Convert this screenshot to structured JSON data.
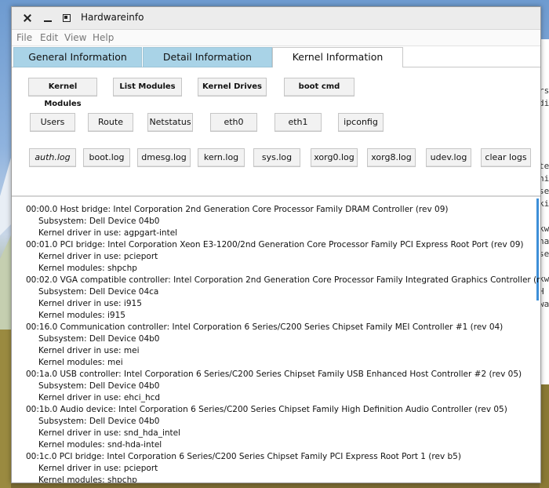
{
  "window": {
    "title": "Hardwareinfo"
  },
  "menu": [
    "File",
    "Edit",
    "View",
    "Help"
  ],
  "tabs": [
    {
      "label": "General Information",
      "active": false
    },
    {
      "label": "Detail Information",
      "active": false
    },
    {
      "label": "Kernel Information",
      "active": true
    }
  ],
  "buttons": {
    "row1": [
      "Kernel Modules",
      "List Modules",
      "Kernel Drives",
      "boot cmd"
    ],
    "row2": [
      "Users",
      "Route",
      "Netstatus",
      "eth0",
      "eth1",
      "ipconfig"
    ],
    "row3": [
      "auth.log",
      "boot.log",
      "dmesg.log",
      "kern.log",
      "sys.log",
      "xorg0.log",
      "xorg8.log",
      "udev.log",
      "clear logs"
    ]
  },
  "output": [
    {
      "text": "00:00.0 Host bridge: Intel Corporation 2nd Generation Core Processor Family DRAM Controller (rev 09)",
      "indent": false
    },
    {
      "text": "Subsystem: Dell Device 04b0",
      "indent": true
    },
    {
      "text": "Kernel driver in use: agpgart-intel",
      "indent": true
    },
    {
      "text": "00:01.0 PCI bridge: Intel Corporation Xeon E3-1200/2nd Generation Core Processor Family PCI Express Root Port (rev 09)",
      "indent": false
    },
    {
      "text": "Kernel driver in use: pcieport",
      "indent": true
    },
    {
      "text": "Kernel modules: shpchp",
      "indent": true
    },
    {
      "text": "00:02.0 VGA compatible controller: Intel Corporation 2nd Generation Core Processor Family Integrated Graphics Controller (rev 09)",
      "indent": false
    },
    {
      "text": "Subsystem: Dell Device 04ca",
      "indent": true
    },
    {
      "text": "Kernel driver in use: i915",
      "indent": true
    },
    {
      "text": "Kernel modules: i915",
      "indent": true
    },
    {
      "text": "00:16.0 Communication controller: Intel Corporation 6 Series/C200 Series Chipset Family MEI Controller #1 (rev 04)",
      "indent": false
    },
    {
      "text": "Subsystem: Dell Device 04b0",
      "indent": true
    },
    {
      "text": "Kernel driver in use: mei",
      "indent": true
    },
    {
      "text": "Kernel modules: mei",
      "indent": true
    },
    {
      "text": "00:1a.0 USB controller: Intel Corporation 6 Series/C200 Series Chipset Family USB Enhanced Host Controller #2 (rev 05)",
      "indent": false
    },
    {
      "text": "Subsystem: Dell Device 04b0",
      "indent": true
    },
    {
      "text": "Kernel driver in use: ehci_hcd",
      "indent": true
    },
    {
      "text": "00:1b.0 Audio device: Intel Corporation 6 Series/C200 Series Chipset Family High Definition Audio Controller (rev 05)",
      "indent": false
    },
    {
      "text": "Subsystem: Dell Device 04b0",
      "indent": true
    },
    {
      "text": "Kernel driver in use: snd_hda_intel",
      "indent": true
    },
    {
      "text": "Kernel modules: snd-hda-intel",
      "indent": true
    },
    {
      "text": "00:1c.0 PCI bridge: Intel Corporation 6 Series/C200 Series Chipset Family PCI Express Root Port 1 (rev b5)",
      "indent": false
    },
    {
      "text": "Kernel driver in use: pcieport",
      "indent": true
    },
    {
      "text": "Kernel modules: shpchp",
      "indent": true
    }
  ],
  "peek": [
    "rs",
    "di",
    "",
    "",
    "",
    "",
    "te",
    "ni",
    "se",
    "ki",
    "",
    "kw",
    "ha",
    "se",
    "",
    "kw",
    "H",
    "wa"
  ],
  "colors": {
    "tab_inactive": "#a9d3e7",
    "scroll_accent": "#3d8fd8"
  }
}
